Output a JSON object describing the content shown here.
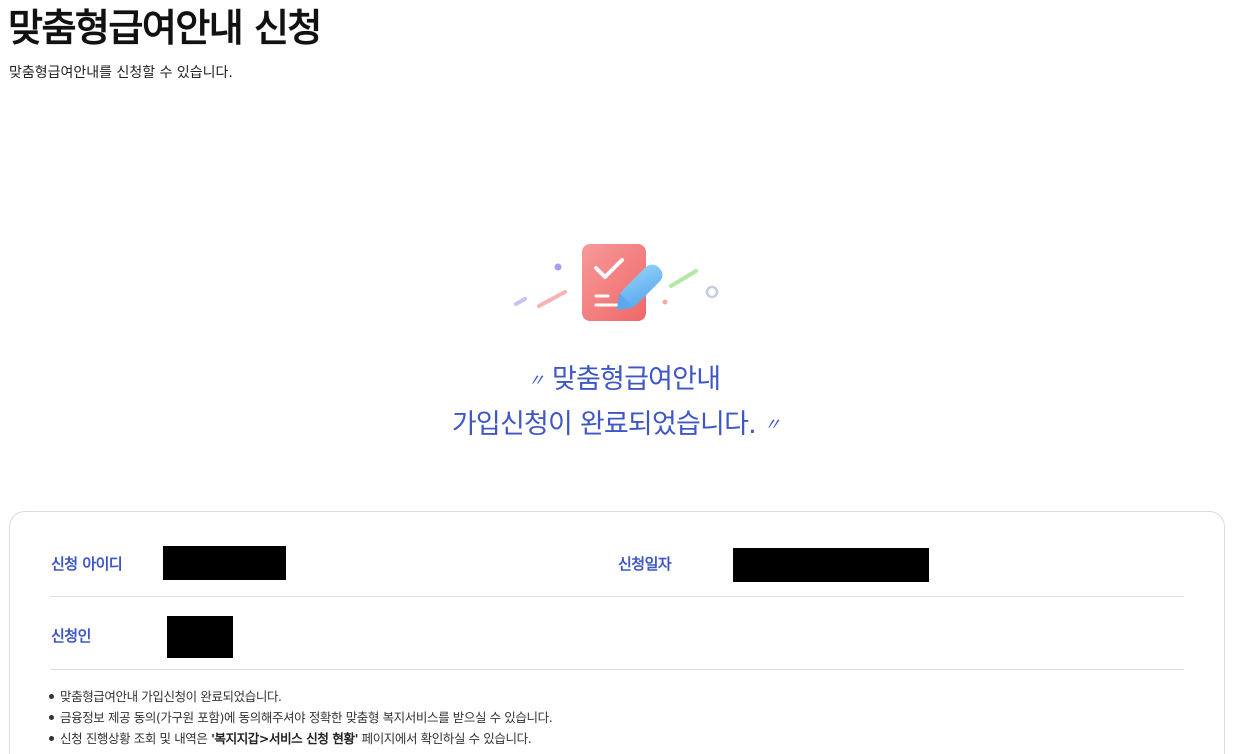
{
  "header": {
    "title": "맞춤형급여안내 신청",
    "subtitle": "맞춤형급여안내를 신청할 수 있습니다."
  },
  "illustration": {
    "icon": "checklist-document-pen-icon",
    "colors": {
      "document": "#f47a7a",
      "pen": "#69b7f2",
      "accent_purple": "#a99cf0",
      "accent_pink": "#f4a9a9",
      "accent_green": "#a7e49a",
      "accent_gray": "#c4cde0"
    }
  },
  "message": {
    "open_quote": "〃",
    "line1": "맞춤형급여안내",
    "line2": "가입신청이 완료되었습니다.",
    "close_quote": "〃",
    "color": "#3f57c6"
  },
  "info": {
    "applicant_id_label": "신청 아이디",
    "apply_date_label": "신청일자",
    "applicant_label": "신청인",
    "applicant_id_value": "[redacted]",
    "apply_date_value": "[redacted]",
    "applicant_value": "[redacted]"
  },
  "notices": {
    "item1": "맞춤형급여안내 가입신청이 완료되었습니다.",
    "item2": "금융정보 제공 동의(가구원 포함)에 동의해주셔야 정확한 맞춤형 복지서비스를 받으실 수 있습니다.",
    "item3_prefix": "신청 진행상황 조회 및 내역은 ",
    "item3_em": "'복지지갑>서비스 신청 현황'",
    "item3_suffix": " 페이지에서 확인하실 수 있습니다."
  }
}
